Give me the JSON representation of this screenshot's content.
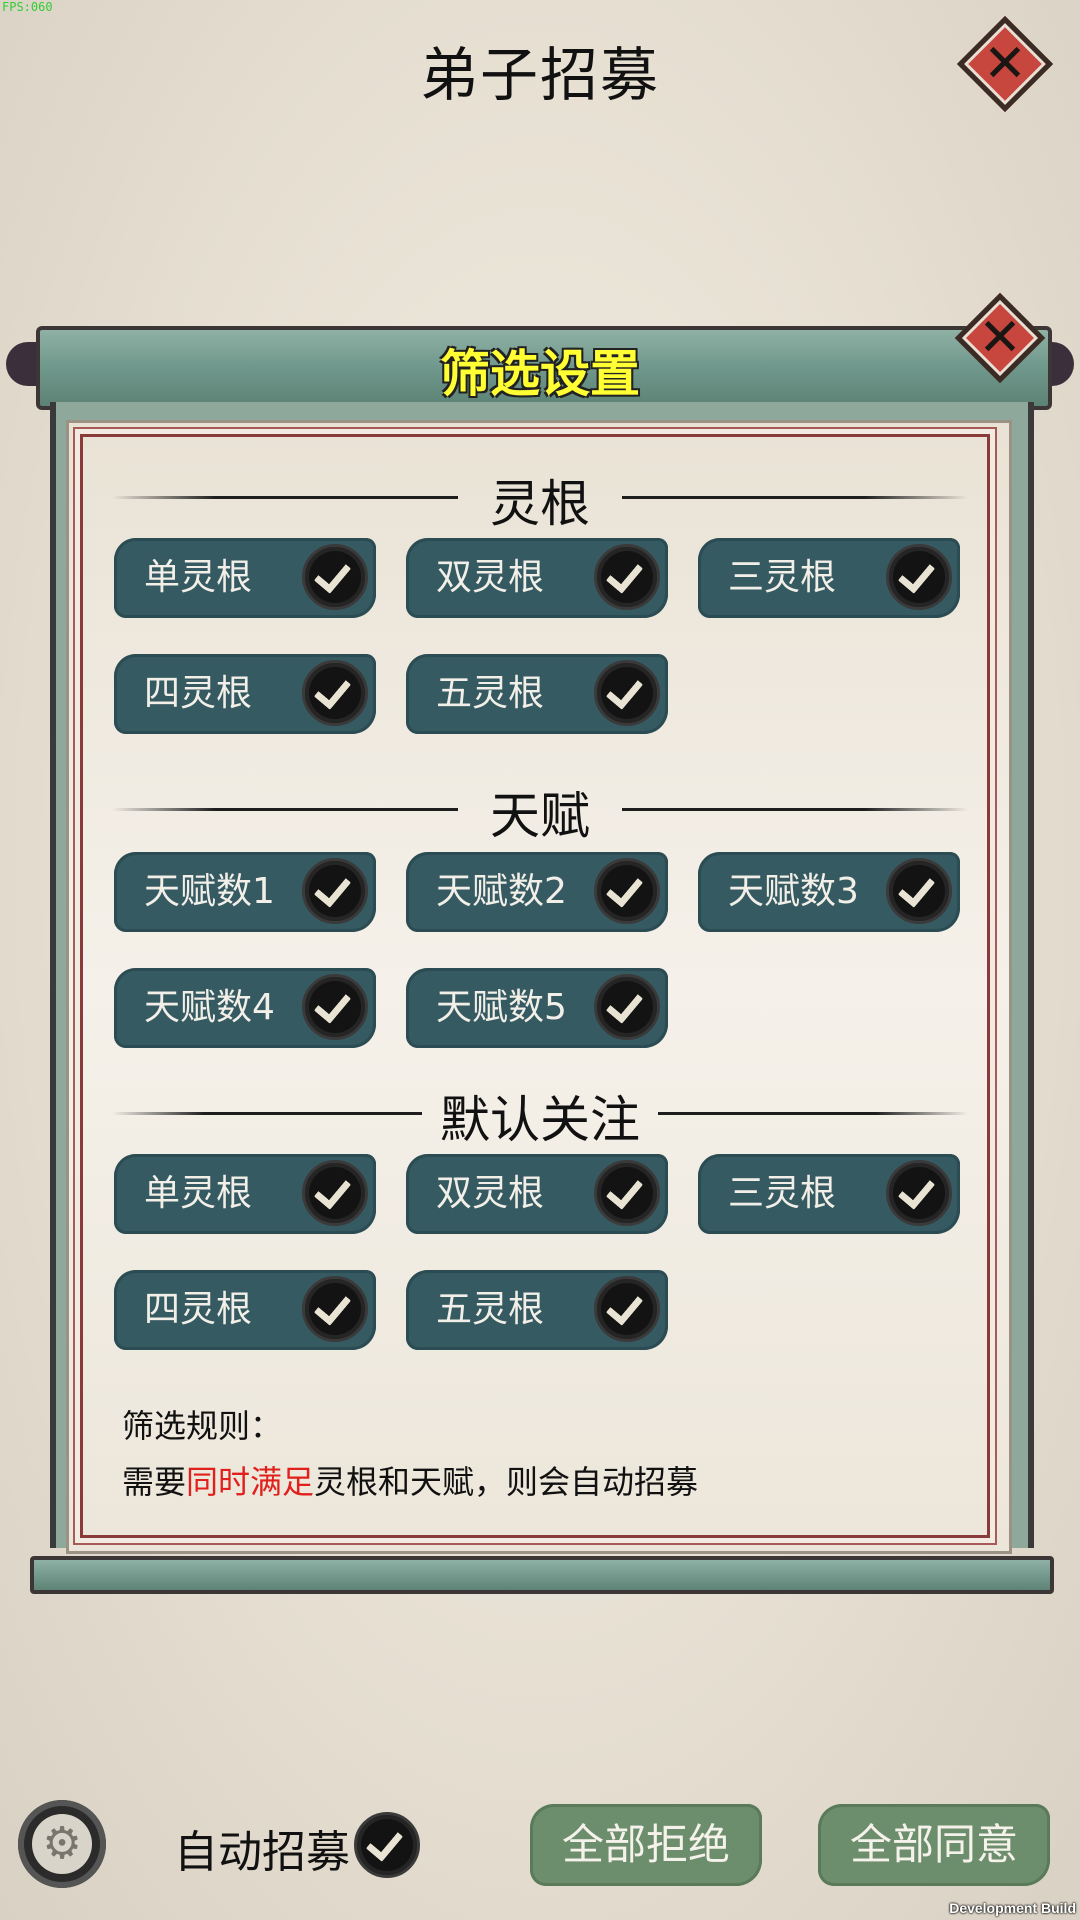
{
  "debug": {
    "fps": "FPS:060",
    "build": "Development Build"
  },
  "page": {
    "title": "弟子招募"
  },
  "panel": {
    "title": "筛选设置",
    "sections": [
      {
        "title": "灵根",
        "options": [
          {
            "label": "单灵根",
            "checked": true
          },
          {
            "label": "双灵根",
            "checked": true
          },
          {
            "label": "三灵根",
            "checked": true
          },
          {
            "label": "四灵根",
            "checked": true
          },
          {
            "label": "五灵根",
            "checked": true
          }
        ]
      },
      {
        "title": "天赋",
        "options": [
          {
            "label": "天赋数1",
            "checked": true
          },
          {
            "label": "天赋数2",
            "checked": true
          },
          {
            "label": "天赋数3",
            "checked": true
          },
          {
            "label": "天赋数4",
            "checked": true
          },
          {
            "label": "天赋数5",
            "checked": true
          }
        ]
      },
      {
        "title": "默认关注",
        "options": [
          {
            "label": "单灵根",
            "checked": true
          },
          {
            "label": "双灵根",
            "checked": true
          },
          {
            "label": "三灵根",
            "checked": true
          },
          {
            "label": "四灵根",
            "checked": true
          },
          {
            "label": "五灵根",
            "checked": true
          }
        ]
      }
    ],
    "rules": {
      "heading": "筛选规则：",
      "prefix": "需要",
      "highlight": "同时满足",
      "suffix": "灵根和天赋，则会自动招募"
    }
  },
  "bottom": {
    "auto_label": "自动招募",
    "auto_checked": true,
    "reject_all": "全部拒绝",
    "accept_all": "全部同意"
  },
  "colors": {
    "chip_bg": "#355a62",
    "button_bg": "#6c8e6c",
    "title_yellow": "#ffff33",
    "close_red": "#c7463e",
    "highlight_red": "#e0201c"
  },
  "icons": {
    "close": "close-icon",
    "check": "checkmark-icon",
    "settings": "gear-icon"
  }
}
